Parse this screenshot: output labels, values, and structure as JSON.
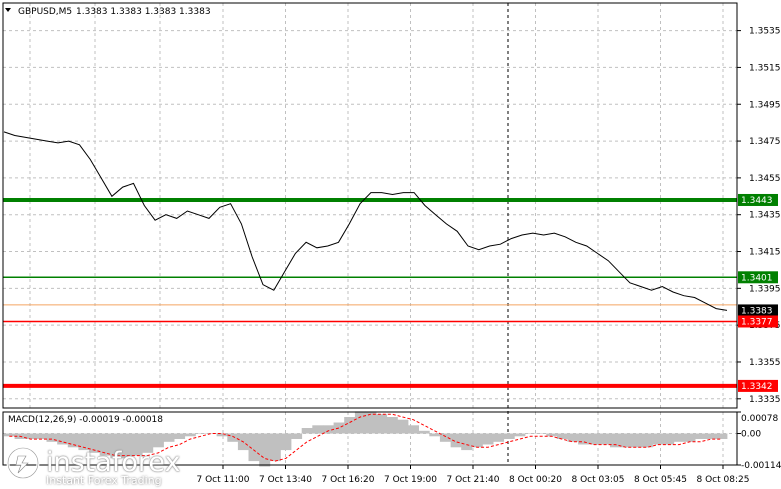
{
  "header": {
    "symbol": "GBPUSD,M5",
    "quote": "1.3383 1.3383 1.3383 1.3383"
  },
  "macd": {
    "label": "MACD(12,26,9) -0.00019 -0.00018"
  },
  "branding": {
    "name": "instaforex",
    "tagline": "Instant Forex Trading"
  },
  "colors": {
    "price_line": "#000000",
    "green_level": "#008000",
    "red_level": "#ff0000",
    "orange_level": "#f4a460",
    "grid": "#c0c0c0",
    "histogram": "#c0c0c0",
    "signal": "#ff0000"
  },
  "chart_data": {
    "type": "line",
    "series": [
      {
        "values": [
          1.348,
          1.3478,
          1.3477,
          1.3476,
          1.3475,
          1.3474,
          1.3475,
          1.3473,
          1.3465,
          1.3455,
          1.3445,
          1.345,
          1.3452,
          1.344,
          1.3432,
          1.3435,
          1.3433,
          1.3437,
          1.3435,
          1.3433,
          1.3439,
          1.3441,
          1.343,
          1.3412,
          1.3397,
          1.3394,
          1.3404,
          1.3414,
          1.342,
          1.3417,
          1.3418,
          1.342,
          1.343,
          1.3441,
          1.3447,
          1.3447,
          1.3446,
          1.3447,
          1.3447,
          1.344,
          1.3435,
          1.343,
          1.3426,
          1.3418,
          1.3416,
          1.3418,
          1.3419,
          1.3422,
          1.3424,
          1.3425,
          1.3424,
          1.3425,
          1.3423,
          1.342,
          1.3418,
          1.3414,
          1.341,
          1.3404,
          1.3398,
          1.3396,
          1.3394,
          1.3396,
          1.3393,
          1.3391,
          1.339,
          1.3387,
          1.3384,
          1.3383
        ]
      }
    ],
    "ylim": [
      1.333,
      1.355
    ],
    "y_ticks": [
      "1.3535",
      "1.3515",
      "1.3495",
      "1.3475",
      "1.3455",
      "1.3435",
      "1.3415",
      "1.3395",
      "1.3375",
      "1.3355",
      "1.3335"
    ],
    "x_ticks": [
      "7 Oct 11:00",
      "7 Oct 13:40",
      "7 Oct 16:20",
      "7 Oct 19:00",
      "7 Oct 21:40",
      "8 Oct 00:20",
      "8 Oct 03:05",
      "8 Oct 05:45",
      "8 Oct 08:25"
    ],
    "levels": [
      {
        "value": 1.3443,
        "label": "1.3443",
        "color": "#008000",
        "weight": "thick"
      },
      {
        "value": 1.3401,
        "label": "1.3401",
        "color": "#008000",
        "weight": "thin"
      },
      {
        "value": 1.3386,
        "label": "",
        "color": "#f4a460",
        "weight": "thin"
      },
      {
        "value": 1.3383,
        "label": "1.3383",
        "color": "#000000",
        "weight": "price"
      },
      {
        "value": 1.3377,
        "label": "1.3377",
        "color": "#ff0000",
        "weight": "thin"
      },
      {
        "value": 1.3342,
        "label": "1.3342",
        "color": "#ff0000",
        "weight": "thick"
      }
    ],
    "macd": {
      "ylim": [
        -0.00114,
        0.00078
      ],
      "y_ticks": [
        "0.00078",
        "0.00",
        "-0.00114"
      ],
      "histogram": [
        -0.0001,
        -0.0002,
        -0.0002,
        -0.0002,
        -0.0003,
        -0.0004,
        -0.0005,
        -0.0006,
        -0.0007,
        -0.0008,
        -0.0009,
        -0.0009,
        -0.0008,
        -0.0007,
        -0.0005,
        -0.0003,
        -0.0002,
        -0.0001,
        0.0,
        0.0,
        -0.0001,
        -0.0003,
        -0.0006,
        -0.001,
        -0.0012,
        -0.001,
        -0.0006,
        -0.0002,
        0.0002,
        0.0003,
        0.0003,
        0.0004,
        0.0006,
        0.0008,
        0.0008,
        0.0007,
        0.0006,
        0.0005,
        0.0003,
        0.0001,
        -0.0001,
        -0.0003,
        -0.0005,
        -0.0006,
        -0.0005,
        -0.0004,
        -0.0003,
        -0.0002,
        -0.0001,
        0.0,
        0.0,
        -0.0001,
        -0.0002,
        -0.0003,
        -0.0004,
        -0.0004,
        -0.0004,
        -0.0005,
        -0.0005,
        -0.0005,
        -0.0005,
        -0.0004,
        -0.0004,
        -0.0003,
        -0.0003,
        -0.0002,
        -0.0002,
        -0.0002
      ],
      "signal": [
        -0.0001,
        -0.0001,
        -0.0002,
        -0.0002,
        -0.0002,
        -0.0003,
        -0.0004,
        -0.0005,
        -0.0006,
        -0.0007,
        -0.0008,
        -0.0008,
        -0.0008,
        -0.0008,
        -0.0007,
        -0.0005,
        -0.0004,
        -0.0002,
        -0.0001,
        0.0,
        0.0,
        -0.0001,
        -0.0003,
        -0.0006,
        -0.0009,
        -0.001,
        -0.0009,
        -0.0006,
        -0.0003,
        -0.0001,
        0.0001,
        0.0002,
        0.0004,
        0.0006,
        0.0007,
        0.0007,
        0.0007,
        0.0006,
        0.0005,
        0.0003,
        0.0001,
        -0.0001,
        -0.0003,
        -0.0004,
        -0.0005,
        -0.0005,
        -0.0004,
        -0.0003,
        -0.0002,
        -0.0001,
        -0.0001,
        -0.0001,
        -0.0002,
        -0.0003,
        -0.0003,
        -0.0004,
        -0.0004,
        -0.0004,
        -0.0005,
        -0.0005,
        -0.0005,
        -0.0004,
        -0.0004,
        -0.0004,
        -0.0003,
        -0.0003,
        -0.0002,
        -0.0002
      ]
    }
  }
}
